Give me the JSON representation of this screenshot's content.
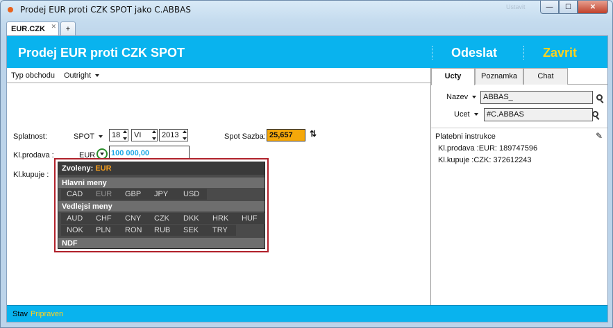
{
  "window": {
    "title": "Prodej EUR proti CZK SPOT jako C.ABBAS",
    "faded_button": "Ustavit",
    "minimize": "—",
    "maximize": "☐",
    "close": "✕"
  },
  "tabs": [
    {
      "label": "EUR.CZK",
      "close": "✕"
    },
    {
      "label": "+"
    }
  ],
  "header": {
    "title": "Prodej EUR proti CZK SPOT",
    "send_label": "Odeslat",
    "close_label": "Zavrit",
    "accent_color": "#09b3ee",
    "close_color": "#ffd21e"
  },
  "form": {
    "trade_type_label": "Typ obchodu",
    "trade_type_value": "Outright",
    "settlement_label": "Splatnost:",
    "settlement_type": "SPOT",
    "day": "18",
    "month": "VI",
    "year": "2013",
    "spot_rate_label": "Spot Sazba:",
    "spot_rate_value": "25,657",
    "sell_label": "Kl.prodava :",
    "sell_currency": "EUR",
    "sell_amount": "100 000,00",
    "buy_label": "Kl.kupuje :"
  },
  "currency_popup": {
    "selected_label": "Zvoleny:",
    "selected_value": "EUR",
    "main_group": "Hlavni meny",
    "main_currencies": [
      "CAD",
      "EUR",
      "GBP",
      "JPY",
      "USD"
    ],
    "minor_group": "Vedlejsi meny",
    "minor_currencies_row1": [
      "AUD",
      "CHF",
      "CNY",
      "CZK",
      "DKK",
      "HRK",
      "HUF"
    ],
    "minor_currencies_row2": [
      "NOK",
      "PLN",
      "RON",
      "RUB",
      "SEK",
      "TRY"
    ],
    "ndf_group": "NDF"
  },
  "right_panel": {
    "tabs": [
      "Ucty",
      "Poznamka",
      "Chat"
    ],
    "name_label": "Nazev",
    "name_value": "ABBAS_",
    "account_label": "Ucet",
    "account_value": "#C.ABBAS",
    "instructions_title": "Platebni instrukce",
    "instruction_sell": "Kl.prodava :EUR: 189747596",
    "instruction_buy": "Kl.kupuje :CZK: 372612243"
  },
  "status": {
    "label": "Stav",
    "value": "Pripraven"
  }
}
